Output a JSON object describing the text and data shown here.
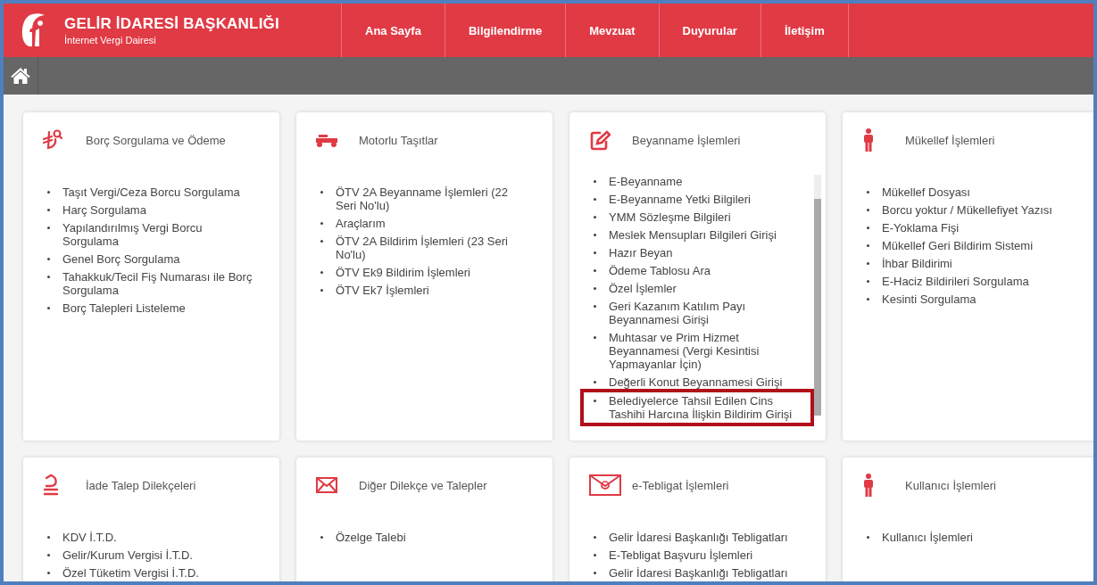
{
  "header": {
    "title": "GELİR İDARESİ BAŞKANLIĞI",
    "subtitle": "İnternet Vergi Dairesi"
  },
  "nav": [
    {
      "label": "Ana Sayfa"
    },
    {
      "label": "Bilgilendirme"
    },
    {
      "label": "Mevzuat"
    },
    {
      "label": "Duyurular"
    },
    {
      "label": "İletişim"
    }
  ],
  "cards": [
    {
      "kind": "debt",
      "title": "Borç Sorgulama ve Ödeme",
      "items": [
        {
          "label": "Taşıt Vergi/Ceza Borcu Sorgulama"
        },
        {
          "label": "Harç Sorgulama"
        },
        {
          "label": "Yapılandırılmış Vergi Borcu Sorgulama"
        },
        {
          "label": "Genel Borç Sorgulama"
        },
        {
          "label": "Tahakkuk/Tecil Fiş Numarası ile Borç Sorgulama"
        },
        {
          "label": "Borç Talepleri Listeleme"
        }
      ]
    },
    {
      "kind": "vehicle",
      "title": "Motorlu Taşıtlar",
      "items": [
        {
          "label": "ÖTV 2A Beyanname İşlemleri (22 Seri No'lu)"
        },
        {
          "label": "Araçlarım"
        },
        {
          "label": "ÖTV 2A Bildirim İşlemleri (23 Seri No'lu)"
        },
        {
          "label": "ÖTV Ek9 Bildirim İşlemleri"
        },
        {
          "label": "ÖTV Ek7 İşlemleri"
        }
      ]
    },
    {
      "kind": "edit",
      "title": "Beyanname İşlemleri",
      "scrollable": true,
      "items": [
        {
          "label": "E-Beyanname"
        },
        {
          "label": "E-Beyanname Yetki Bilgileri"
        },
        {
          "label": "YMM Sözleşme Bilgileri"
        },
        {
          "label": "Meslek Mensupları Bilgileri Girişi"
        },
        {
          "label": "Hazır Beyan"
        },
        {
          "label": "Ödeme Tablosu Ara"
        },
        {
          "label": "Özel İşlemler"
        },
        {
          "label": "Geri Kazanım Katılım Payı Beyannamesi Girişi"
        },
        {
          "label": "Muhtasar ve Prim Hizmet Beyannamesi (Vergi Kesintisi Yapmayanlar İçin)"
        },
        {
          "label": "Değerli Konut Beyannamesi Girişi"
        },
        {
          "label": "Belediyelerce Tahsil Edilen Cins Tashihi Harcına İlişkin Bildirim Girişi",
          "highlighted": true
        }
      ]
    },
    {
      "kind": "person",
      "title": "Mükellef İşlemleri",
      "items": [
        {
          "label": "Mükellef Dosyası"
        },
        {
          "label": "Borcu yoktur / Mükellefiyet Yazısı"
        },
        {
          "label": "E-Yoklama Fişi"
        },
        {
          "label": "Mükellef Geri Bildirim Sistemi"
        },
        {
          "label": "İhbar Bildirimi"
        },
        {
          "label": "E-Haciz Bildirileri Sorgulama"
        },
        {
          "label": "Kesinti Sorgulama"
        }
      ]
    },
    {
      "kind": "refund",
      "title": "İade Talep Dilekçeleri",
      "items": [
        {
          "label": "KDV İ.T.D."
        },
        {
          "label": "Gelir/Kurum Vergisi İ.T.D."
        },
        {
          "label": "Özel Tüketim Vergisi İ.T.D."
        }
      ]
    },
    {
      "kind": "envelope",
      "title": "Diğer Dilekçe ve Talepler",
      "items": [
        {
          "label": "Özelge Talebi"
        }
      ]
    },
    {
      "kind": "email",
      "title": "e-Tebligat İşlemleri",
      "items": [
        {
          "label": "Gelir İdaresi Başkanlığı Tebligatları"
        },
        {
          "label": "E-Tebligat Başvuru İşlemleri"
        },
        {
          "label": "Gelir İdaresi Başkanlığı Tebligatları"
        }
      ]
    },
    {
      "kind": "person",
      "title": "Kullanıcı İşlemleri",
      "items": [
        {
          "label": "Kullanıcı İşlemleri"
        }
      ]
    }
  ]
}
